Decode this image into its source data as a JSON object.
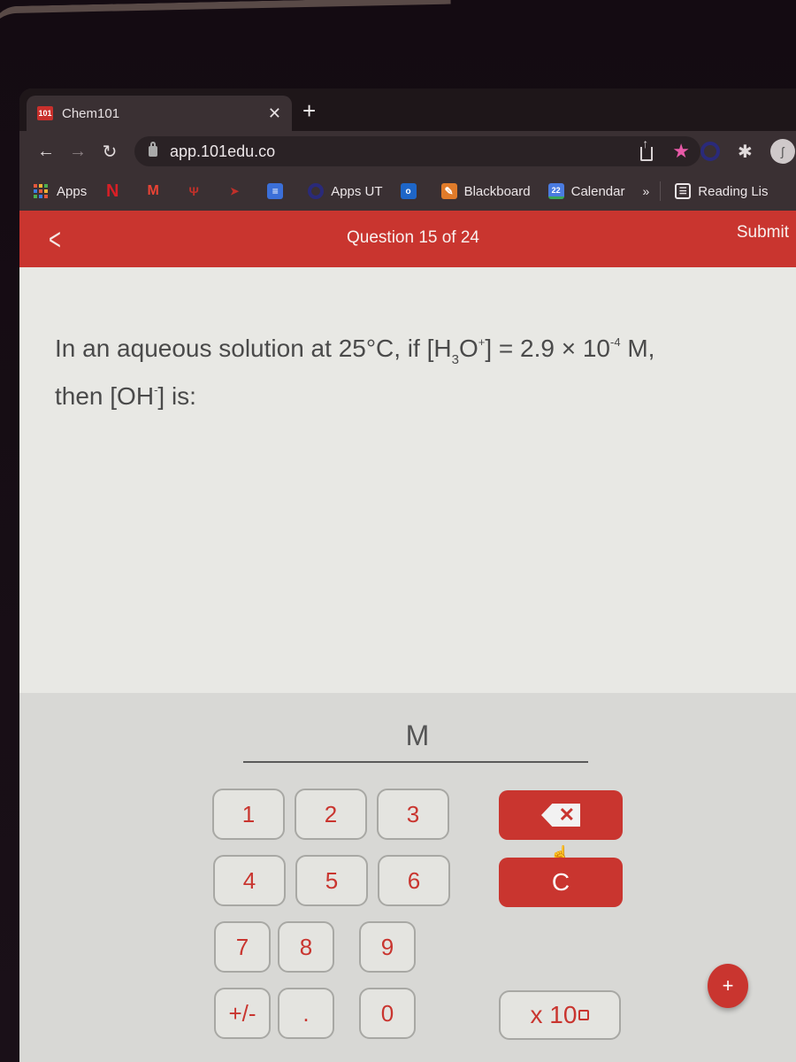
{
  "browser": {
    "tab": {
      "favicon_text": "101",
      "title": "Chem101"
    },
    "new_tab_label": "+",
    "url": "app.101edu.co",
    "toolbar_icons": [
      "back-arrow-icon",
      "forward-arrow-icon",
      "reload-icon",
      "share-icon",
      "bookmark-star-icon",
      "extension-icon",
      "profile-avatar",
      "menu-icon"
    ],
    "bookmarks": [
      {
        "label": "Apps",
        "icon": "apps-grid-icon"
      },
      {
        "label": "",
        "icon": "netflix-icon"
      },
      {
        "label": "",
        "icon": "gmail-icon"
      },
      {
        "label": "",
        "icon": "ut-logo-icon"
      },
      {
        "label": "",
        "icon": "arrow-bookmark-icon"
      },
      {
        "label": "",
        "icon": "google-docs-icon"
      },
      {
        "label": "Apps UT",
        "icon": "ring-icon"
      },
      {
        "label": "",
        "icon": "outlook-icon"
      },
      {
        "label": "Blackboard",
        "icon": "blackboard-icon"
      },
      {
        "label": "Calendar",
        "icon": "calendar-icon",
        "icon_text": "22"
      }
    ],
    "overflow_label": "»",
    "reading_list_label": "Reading Lis"
  },
  "app": {
    "header": {
      "back_label": "<",
      "question_counter": "Question 15 of 24",
      "submit_label": "Submit"
    },
    "question": {
      "prefix": "In an aqueous solution at 25°C, if [H",
      "sub": "3",
      "middle": "O",
      "sup1": "+",
      "value": "] = 2.9 × 10",
      "exponent": "-4",
      "suffix": " M,",
      "line2_prefix": "then [OH",
      "sup2": "-",
      "line2_suffix": "] is:"
    },
    "answer": {
      "current_value": "",
      "unit": "M"
    },
    "keypad": {
      "keys": [
        "1",
        "2",
        "3",
        "4",
        "5",
        "6",
        "7",
        "8",
        "9",
        "+/-",
        ".",
        "0"
      ],
      "backspace_icon": "backspace-icon",
      "clear_label": "C",
      "exponent_label": "x 10",
      "fab_label": "+"
    }
  },
  "colors": {
    "brand_red": "#c9352f",
    "page_bg": "#e8e8e4",
    "keypad_bg": "#d8d8d5"
  }
}
